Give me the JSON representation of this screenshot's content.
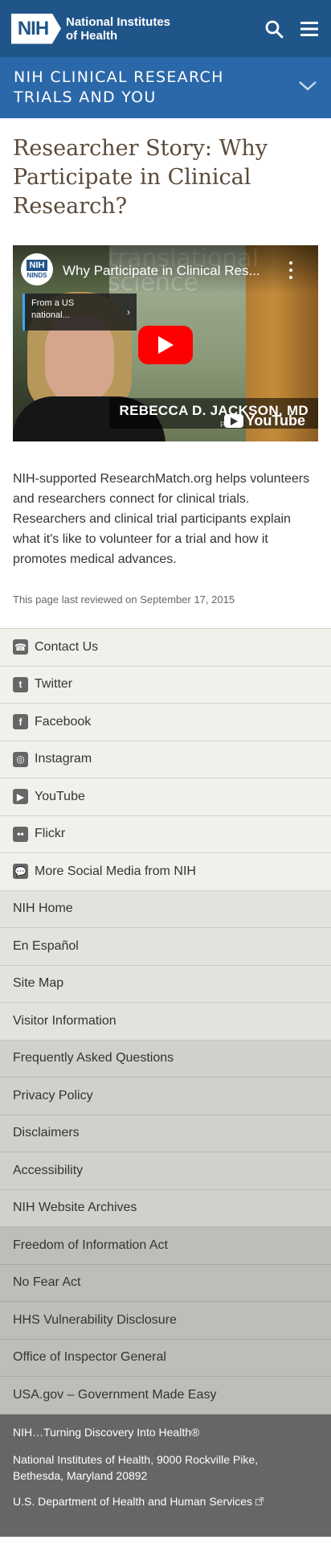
{
  "header": {
    "logo_abbr": "NIH",
    "logo_name_line1": "National Institutes",
    "logo_name_line2": "of Health"
  },
  "banner": {
    "title": "NIH CLINICAL RESEARCH TRIALS AND YOU"
  },
  "page": {
    "title": "Researcher Story: Why Participate in Clinical Research?",
    "description": "NIH-supported ResearchMatch.org helps volunteers and researchers connect for clinical trials. Researchers and clinical trial participants explain what it's like to volunteer for a trial and how it promotes medical advances.",
    "reviewed": "This page last reviewed on September 17, 2015"
  },
  "video": {
    "title": "Why Participate in Clinical Res...",
    "channel_abbr": "NIH",
    "channel_sub": "NINDS",
    "card_line1": "From a US",
    "card_line2": "national...",
    "caption": "REBECCA D. JACKSON, MD",
    "caption_sub": "PHYS",
    "watermark_line1": "translational",
    "watermark_line2": "science",
    "yt_label": "YouTube"
  },
  "social": [
    {
      "label": "Contact Us",
      "icon": "phone-icon"
    },
    {
      "label": "Twitter",
      "icon": "twitter-icon"
    },
    {
      "label": "Facebook",
      "icon": "facebook-icon"
    },
    {
      "label": "Instagram",
      "icon": "instagram-icon"
    },
    {
      "label": "YouTube",
      "icon": "youtube-icon"
    },
    {
      "label": "Flickr",
      "icon": "flickr-icon"
    },
    {
      "label": "More Social Media from NIH",
      "icon": "chat-icon"
    }
  ],
  "links_group1": [
    "NIH Home",
    "En Español",
    "Site Map",
    "Visitor Information"
  ],
  "links_group2": [
    "Frequently Asked Questions",
    "Privacy Policy",
    "Disclaimers",
    "Accessibility",
    "NIH Website Archives"
  ],
  "links_group3": [
    "Freedom of Information Act",
    "No Fear Act",
    "HHS Vulnerability Disclosure",
    "Office of Inspector General",
    "USA.gov – Government Made Easy"
  ],
  "footer": {
    "tagline": "NIH…Turning Discovery Into Health®",
    "address_line1": "National Institutes of Health, 9000 Rockville Pike,",
    "address_line2": "Bethesda, Maryland 20892",
    "hhs": "U.S. Department of Health and Human Services"
  },
  "colors": {
    "header_bg": "#20558a",
    "banner_bg": "#2b68a9",
    "title_color": "#5a4a3a",
    "footer_bg": "#666666"
  }
}
